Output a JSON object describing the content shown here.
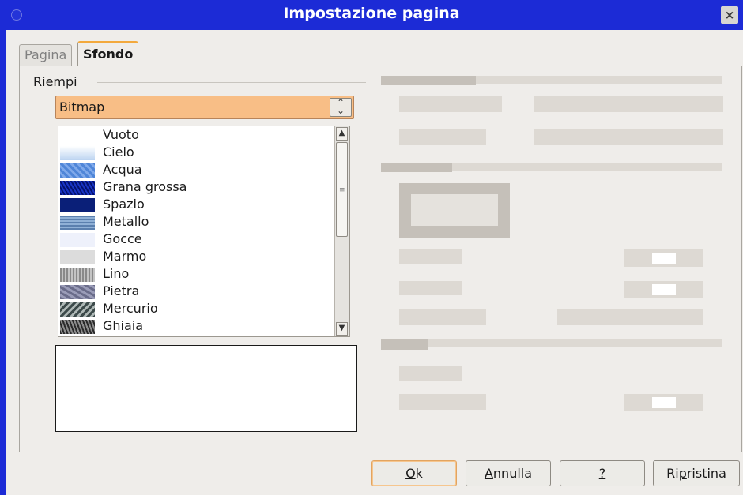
{
  "window": {
    "title": "Impostazione pagina",
    "close_label": "×"
  },
  "tabs": [
    {
      "label": "Pagina",
      "active": false
    },
    {
      "label": "Sfondo",
      "active": true
    }
  ],
  "fill": {
    "group_label": "Riempi",
    "type_value": "Bitmap",
    "bitmaps": [
      {
        "label": "Vuoto"
      },
      {
        "label": "Cielo"
      },
      {
        "label": "Acqua"
      },
      {
        "label": "Grana grossa"
      },
      {
        "label": "Spazio"
      },
      {
        "label": "Metallo"
      },
      {
        "label": "Gocce"
      },
      {
        "label": "Marmo"
      },
      {
        "label": "Lino"
      },
      {
        "label": "Pietra"
      },
      {
        "label": "Mercurio"
      },
      {
        "label": "Ghiaia"
      }
    ]
  },
  "buttons": {
    "ok": {
      "accel": "O",
      "rest": "k"
    },
    "cancel": {
      "accel": "A",
      "rest": "nnulla"
    },
    "help": {
      "accel": "?",
      "rest": ""
    },
    "reset": {
      "pre": "Ri",
      "accel": "p",
      "rest": "ristina"
    }
  },
  "colors": {
    "title_bar": "#1c2bd6",
    "dropdown_highlight": "#f8be86",
    "dialog_bg": "#efedea"
  }
}
